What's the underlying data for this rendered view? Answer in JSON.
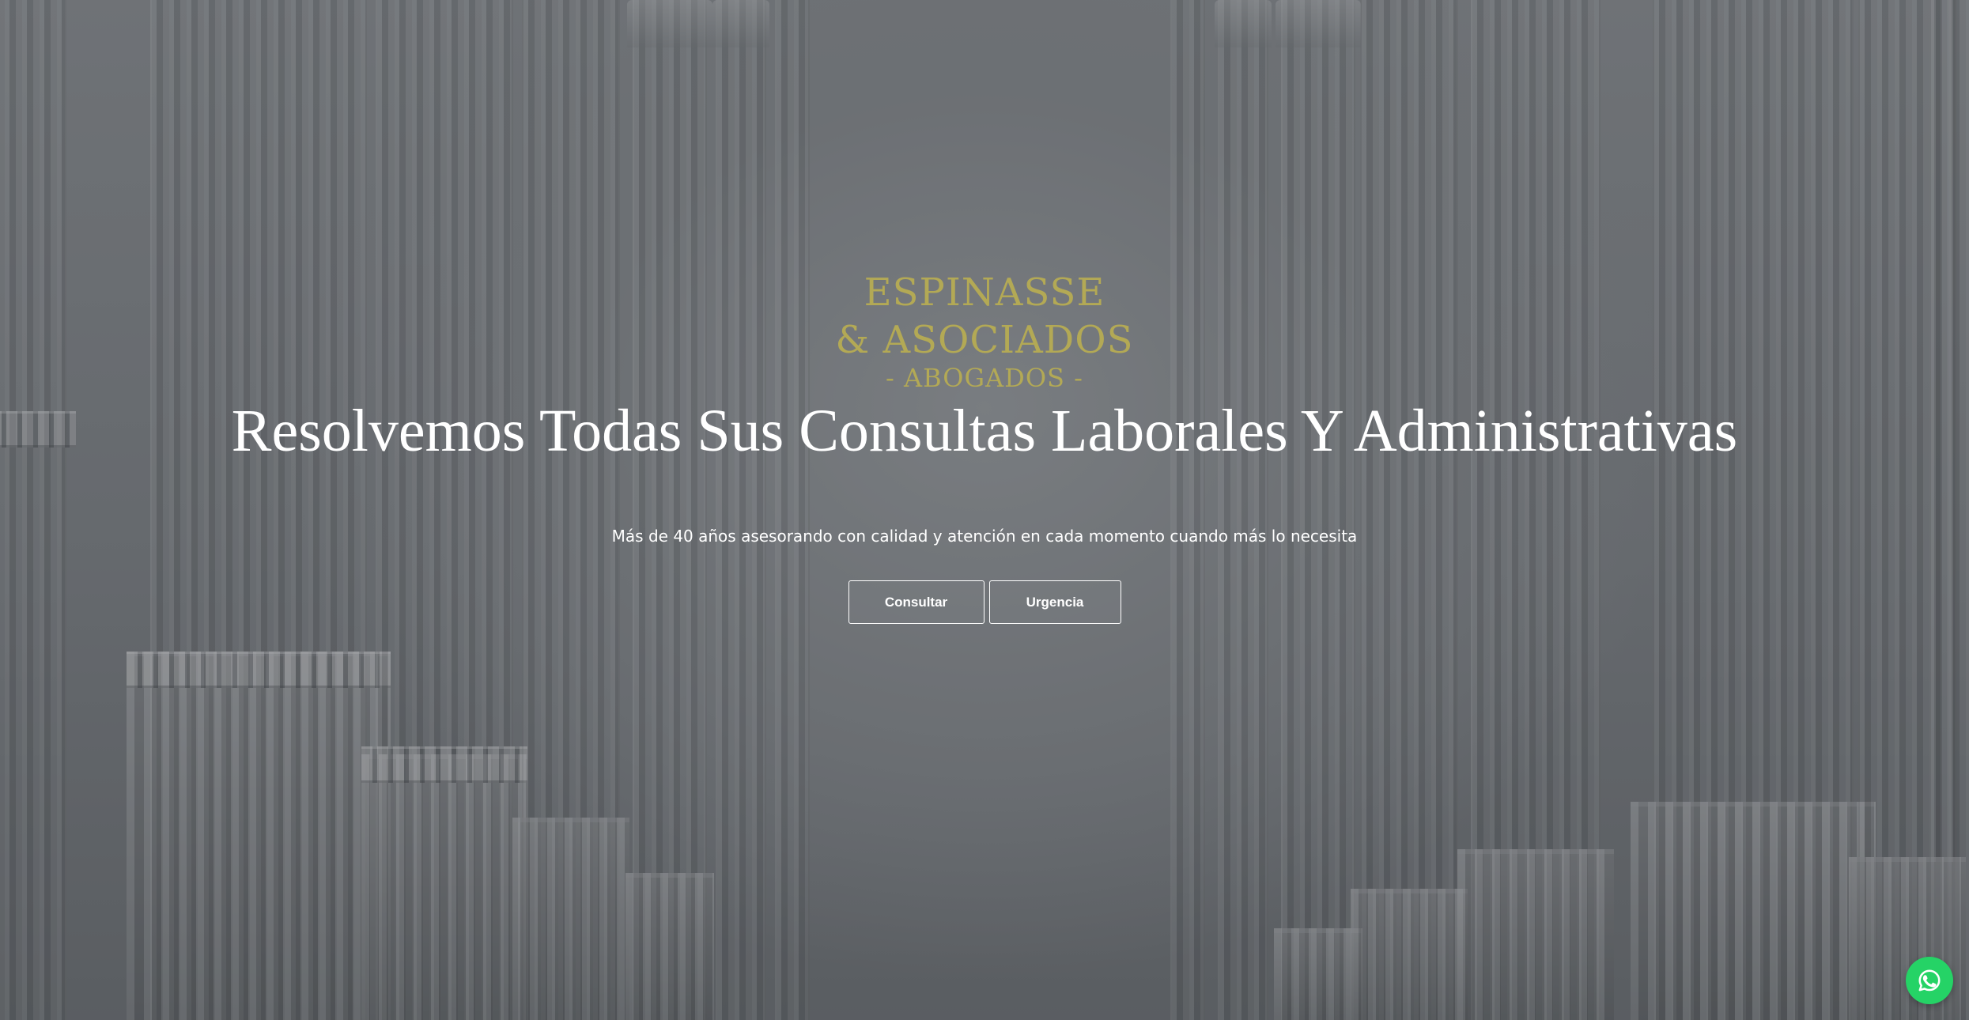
{
  "brand": {
    "line1": "ESPINASSE",
    "line2": "& ASOCIADOS",
    "line3": "- ABOGADOS -",
    "color": "#b3a955"
  },
  "hero": {
    "headline": "Resolvemos Todas Sus Consultas Laborales Y Administrativas",
    "subtitle": "Más de 40 años asesorando con calidad y atención en cada momento cuando más lo necesita",
    "buttons": {
      "consultar": "Consultar",
      "urgencia": "Urgencia"
    },
    "background": "colonnade-photo"
  },
  "whatsapp": {
    "icon": "whatsapp-icon",
    "color": "#25d366"
  }
}
